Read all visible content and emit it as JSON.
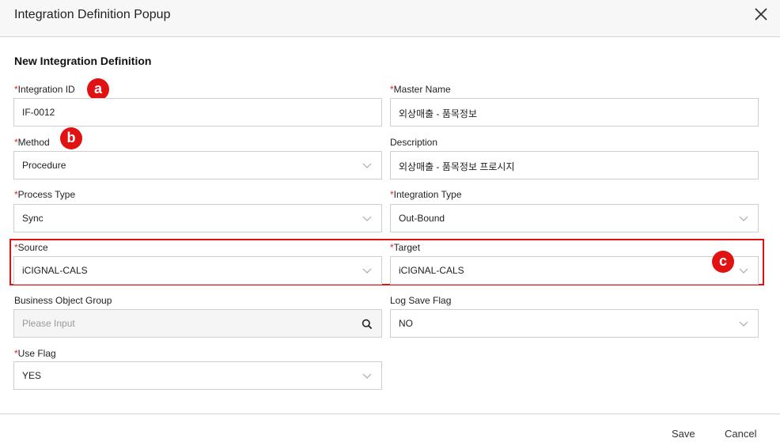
{
  "dialog": {
    "title": "Integration Definition Popup",
    "close_icon": "close-icon"
  },
  "section": {
    "title": "New Integration Definition"
  },
  "required_mark": "*",
  "fields": {
    "integration_id": {
      "label": "Integration ID",
      "value": "IF-0012"
    },
    "master_name": {
      "label": "Master Name",
      "value": "외상매출 - 품목정보"
    },
    "method": {
      "label": "Method",
      "value": "Procedure"
    },
    "description": {
      "label": "Description",
      "value": "외상매출 - 품목정보 프로시지"
    },
    "process_type": {
      "label": "Process Type",
      "value": "Sync"
    },
    "integration_type": {
      "label": "Integration Type",
      "value": "Out-Bound"
    },
    "source": {
      "label": "Source",
      "value": "iCIGNAL-CALS"
    },
    "target": {
      "label": "Target",
      "value": "iCIGNAL-CALS"
    },
    "business_object_group": {
      "label": "Business Object Group",
      "placeholder": "Please Input"
    },
    "log_save_flag": {
      "label": "Log Save Flag",
      "value": "NO"
    },
    "use_flag": {
      "label": "Use Flag",
      "value": "YES"
    }
  },
  "annotations": {
    "a": "a",
    "b": "b",
    "c": "c"
  },
  "footer": {
    "save_label": "Save",
    "cancel_label": "Cancel"
  },
  "colors": {
    "required": "#e0252b",
    "annotation": "#e01212",
    "header_bg": "#f7f7f7"
  }
}
